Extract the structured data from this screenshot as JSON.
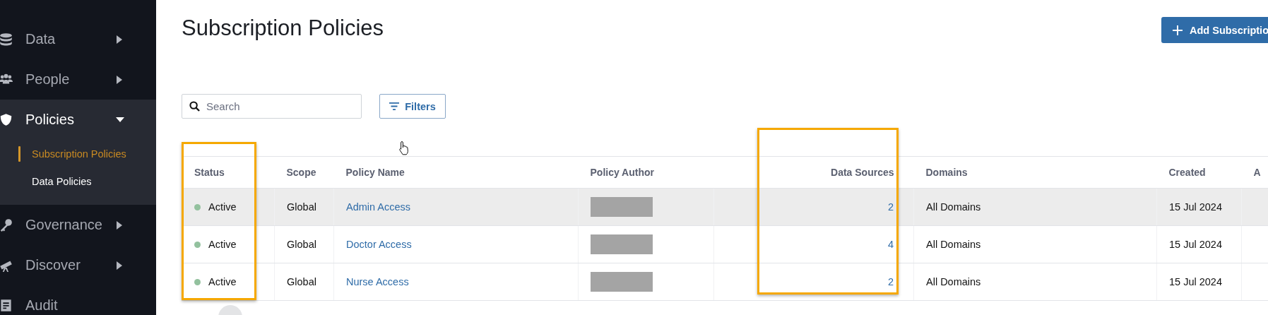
{
  "sidebar": {
    "items": [
      {
        "label": "Data",
        "expandable": true,
        "expanded": false
      },
      {
        "label": "People",
        "expandable": true,
        "expanded": false
      },
      {
        "label": "Policies",
        "expandable": true,
        "expanded": true,
        "children": [
          {
            "label": "Subscription Policies",
            "selected": true
          },
          {
            "label": "Data Policies",
            "selected": false
          }
        ]
      },
      {
        "label": "Governance",
        "expandable": true,
        "expanded": false
      },
      {
        "label": "Discover",
        "expandable": true,
        "expanded": false
      },
      {
        "label": "Audit",
        "expandable": false,
        "expanded": false
      }
    ]
  },
  "page": {
    "title": "Subscription Policies",
    "add_button": "Add Subscriptio"
  },
  "search": {
    "placeholder": "Search"
  },
  "filters_button": "Filters",
  "table": {
    "columns": [
      "Status",
      "Scope",
      "Policy Name",
      "Policy Author",
      "Data Sources",
      "Domains",
      "Created",
      "A"
    ],
    "rows": [
      {
        "highlighted": true,
        "status": "Active",
        "color": "#93c19e",
        "scope": "Global",
        "policy_name": "Admin Access",
        "data_sources": "2",
        "domains": "All Domains",
        "created": "15 Jul 2024"
      },
      {
        "highlighted": false,
        "status": "Active",
        "color": "#93c19e",
        "scope": "Global",
        "policy_name": "Doctor Access",
        "data_sources": "4",
        "domains": "All Domains",
        "created": "15 Jul 2024"
      },
      {
        "highlighted": false,
        "status": "Active",
        "color": "#93c19e",
        "scope": "Global",
        "policy_name": "Nurse Access",
        "data_sources": "2",
        "domains": "All Domains",
        "created": "15 Jul 2024"
      }
    ]
  }
}
